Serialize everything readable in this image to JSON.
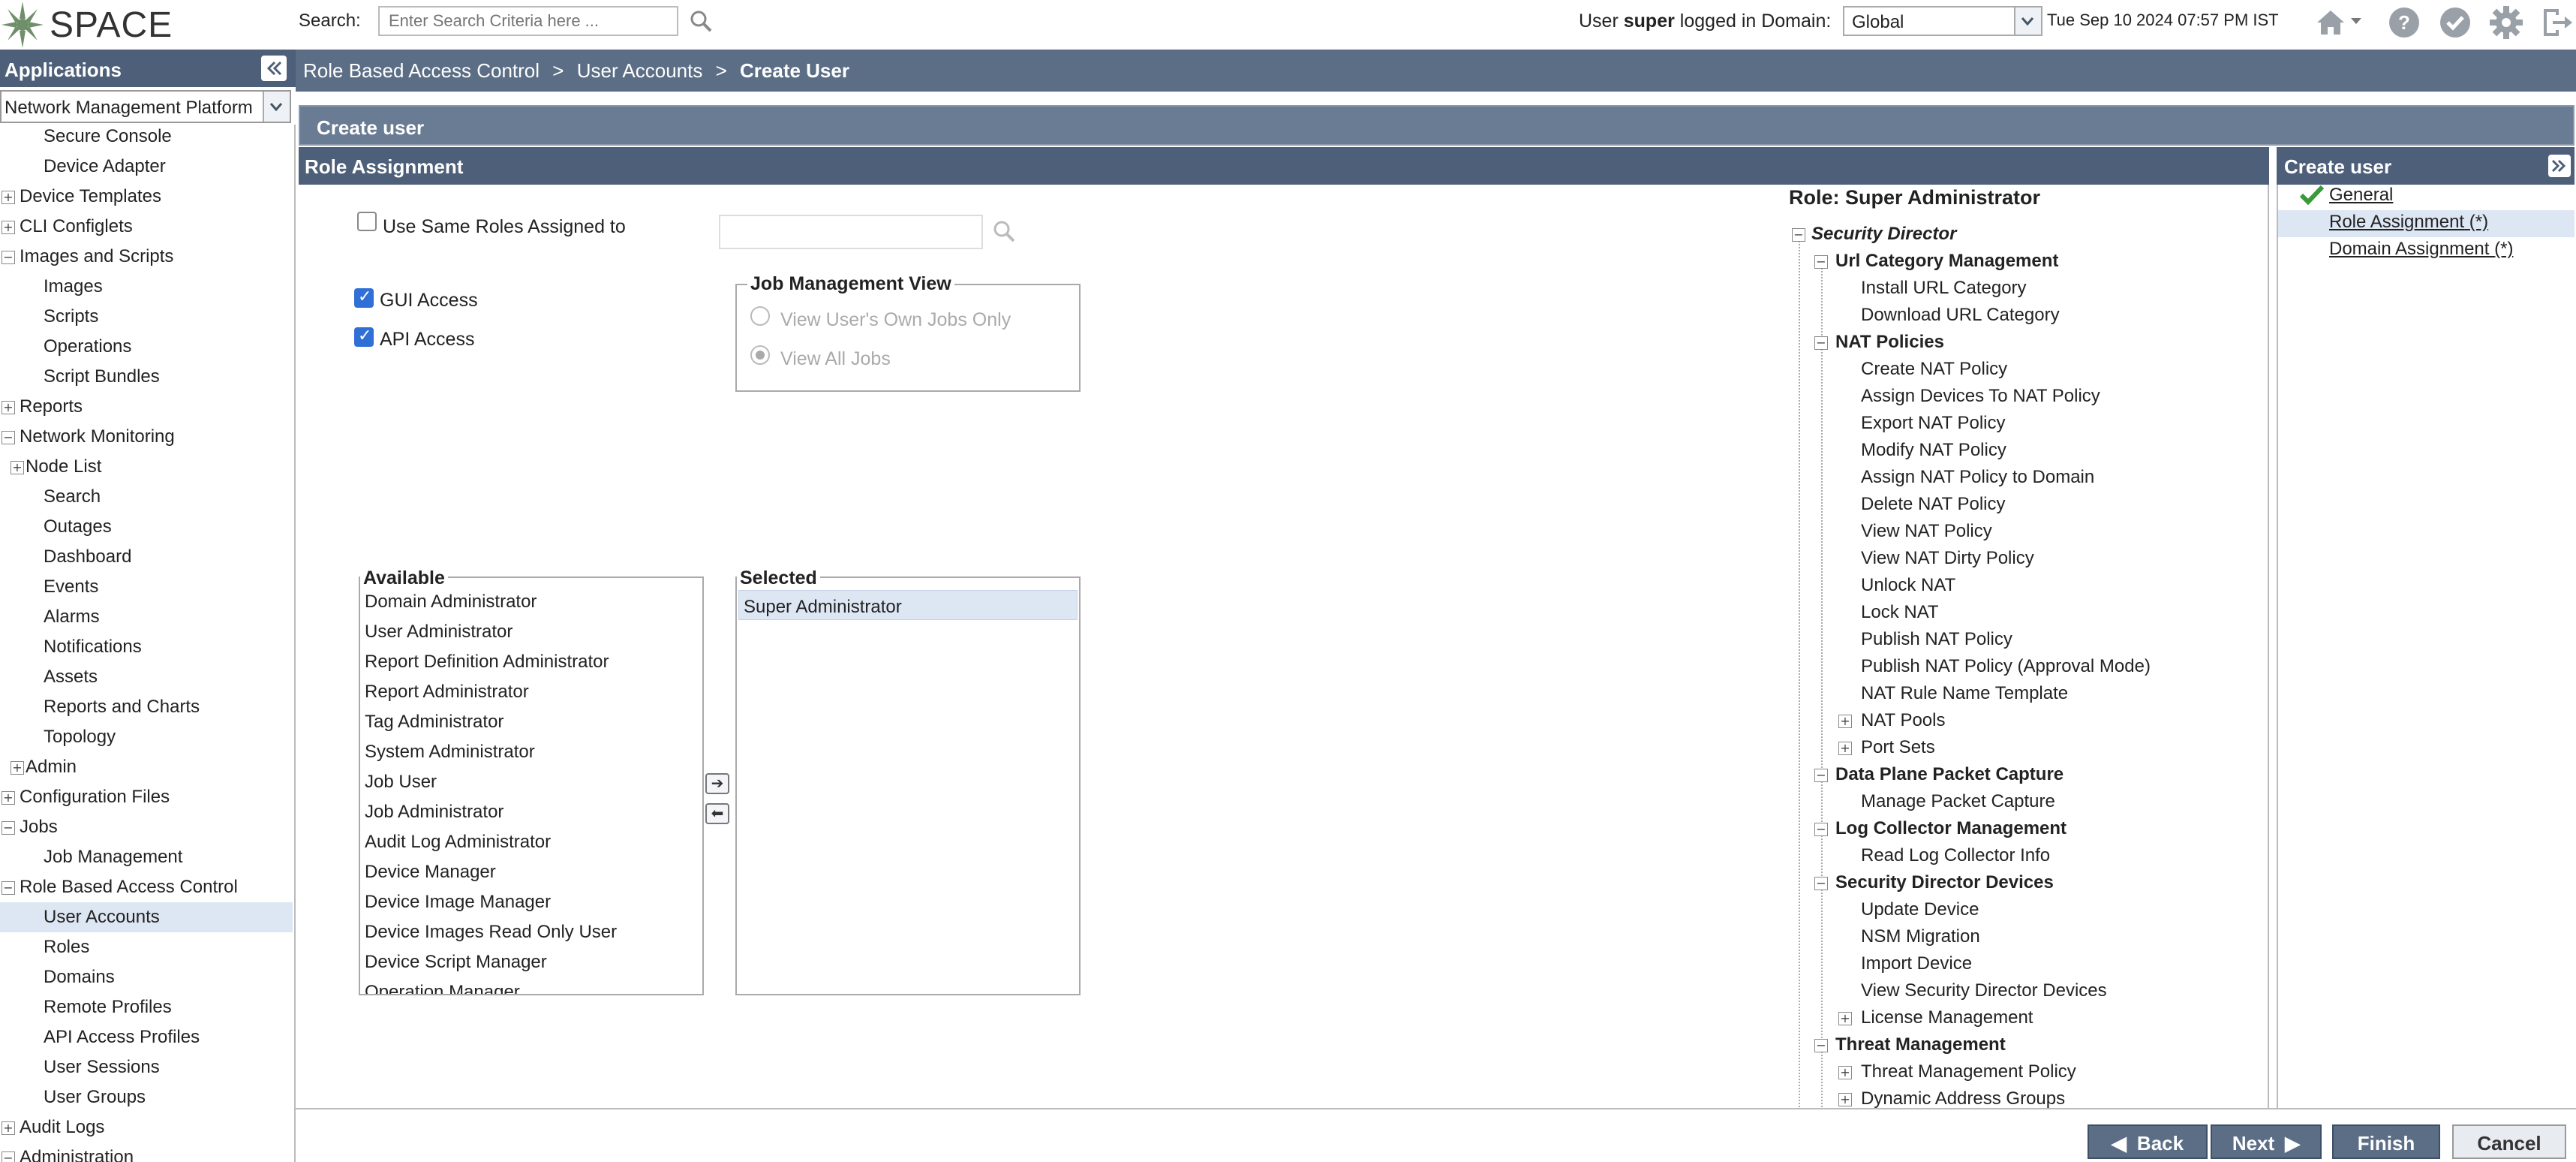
{
  "header": {
    "logo_text": "SPACE",
    "search_label": "Search:",
    "search_placeholder": "Enter Search Criteria here ...",
    "user_prefix": "User",
    "user_name": "super",
    "user_suffix": "logged in Domain:",
    "domain_value": "Global",
    "datetime": "Tue Sep 10 2024 07:57 PM IST"
  },
  "sidebar": {
    "title": "Applications",
    "app_select": "Network Management Platform",
    "items": [
      {
        "label": "Secure Console",
        "level": 2,
        "box": ""
      },
      {
        "label": "Device Adapter",
        "level": 2,
        "box": ""
      },
      {
        "label": "Device Templates",
        "level": 0,
        "box": "+"
      },
      {
        "label": "CLI Configlets",
        "level": 0,
        "box": "+"
      },
      {
        "label": "Images and Scripts",
        "level": 0,
        "box": "−"
      },
      {
        "label": "Images",
        "level": 2,
        "box": ""
      },
      {
        "label": "Scripts",
        "level": 2,
        "box": ""
      },
      {
        "label": "Operations",
        "level": 2,
        "box": ""
      },
      {
        "label": "Script Bundles",
        "level": 2,
        "box": ""
      },
      {
        "label": "Reports",
        "level": 0,
        "box": "+"
      },
      {
        "label": "Network Monitoring",
        "level": 0,
        "box": "−"
      },
      {
        "label": "Node List",
        "level": 1,
        "box": "+"
      },
      {
        "label": "Search",
        "level": 2,
        "box": ""
      },
      {
        "label": "Outages",
        "level": 2,
        "box": ""
      },
      {
        "label": "Dashboard",
        "level": 2,
        "box": ""
      },
      {
        "label": "Events",
        "level": 2,
        "box": ""
      },
      {
        "label": "Alarms",
        "level": 2,
        "box": ""
      },
      {
        "label": "Notifications",
        "level": 2,
        "box": ""
      },
      {
        "label": "Assets",
        "level": 2,
        "box": ""
      },
      {
        "label": "Reports and Charts",
        "level": 2,
        "box": ""
      },
      {
        "label": "Topology",
        "level": 2,
        "box": ""
      },
      {
        "label": "Admin",
        "level": 1,
        "box": "+"
      },
      {
        "label": "Configuration Files",
        "level": 0,
        "box": "+"
      },
      {
        "label": "Jobs",
        "level": 0,
        "box": "−"
      },
      {
        "label": "Job Management",
        "level": 2,
        "box": ""
      },
      {
        "label": "Role Based Access Control",
        "level": 0,
        "box": "−"
      },
      {
        "label": "User Accounts",
        "level": 2,
        "box": "",
        "selected": true
      },
      {
        "label": "Roles",
        "level": 2,
        "box": ""
      },
      {
        "label": "Domains",
        "level": 2,
        "box": ""
      },
      {
        "label": "Remote Profiles",
        "level": 2,
        "box": ""
      },
      {
        "label": "API Access Profiles",
        "level": 2,
        "box": ""
      },
      {
        "label": "User Sessions",
        "level": 2,
        "box": ""
      },
      {
        "label": "User Groups",
        "level": 2,
        "box": ""
      },
      {
        "label": "Audit Logs",
        "level": 0,
        "box": "+"
      },
      {
        "label": "Administration",
        "level": 0,
        "box": "−"
      }
    ]
  },
  "breadcrumb": {
    "items": [
      "Role Based Access Control",
      "User Accounts"
    ],
    "separator": ">",
    "current": "Create User"
  },
  "form": {
    "title": "Create user",
    "section": "Role Assignment",
    "use_same_roles_label": "Use Same Roles Assigned to",
    "gui_access_label": "GUI Access",
    "api_access_label": "API Access",
    "job_view_legend": "Job Management View",
    "job_view_own": "View User's Own Jobs Only",
    "job_view_all": "View All Jobs",
    "available_legend": "Available",
    "selected_legend": "Selected",
    "available_roles": [
      "Domain Administrator",
      "User Administrator",
      "Report Definition Administrator",
      "Report Administrator",
      "Tag Administrator",
      "System Administrator",
      "Job User",
      "Job Administrator",
      "Audit Log Administrator",
      "Device Manager",
      "Device Image Manager",
      "Device Images Read Only User",
      "Device Script Manager",
      "Operation Manager"
    ],
    "selected_roles": [
      "Super Administrator"
    ],
    "move_right": "➔",
    "move_left": "⬅"
  },
  "role_tree": {
    "title": "Role: Super Administrator",
    "nodes": [
      {
        "label": "Security Director",
        "level": 0,
        "box": "−",
        "style": "bi"
      },
      {
        "label": "Url Category Management",
        "level": 1,
        "box": "−",
        "style": "b"
      },
      {
        "label": "Install URL Category",
        "level": 2,
        "box": "",
        "style": ""
      },
      {
        "label": "Download URL Category",
        "level": 2,
        "box": "",
        "style": ""
      },
      {
        "label": "NAT Policies",
        "level": 1,
        "box": "−",
        "style": "b"
      },
      {
        "label": "Create NAT Policy",
        "level": 2,
        "box": "",
        "style": ""
      },
      {
        "label": "Assign Devices To NAT Policy",
        "level": 2,
        "box": "",
        "style": ""
      },
      {
        "label": "Export NAT Policy",
        "level": 2,
        "box": "",
        "style": ""
      },
      {
        "label": "Modify NAT Policy",
        "level": 2,
        "box": "",
        "style": ""
      },
      {
        "label": "Assign NAT Policy to Domain",
        "level": 2,
        "box": "",
        "style": ""
      },
      {
        "label": "Delete NAT Policy",
        "level": 2,
        "box": "",
        "style": ""
      },
      {
        "label": "View NAT Policy",
        "level": 2,
        "box": "",
        "style": ""
      },
      {
        "label": "View NAT Dirty Policy",
        "level": 2,
        "box": "",
        "style": ""
      },
      {
        "label": "Unlock NAT",
        "level": 2,
        "box": "",
        "style": ""
      },
      {
        "label": "Lock NAT",
        "level": 2,
        "box": "",
        "style": ""
      },
      {
        "label": "Publish NAT Policy",
        "level": 2,
        "box": "",
        "style": ""
      },
      {
        "label": "Publish NAT Policy (Approval Mode)",
        "level": 2,
        "box": "",
        "style": ""
      },
      {
        "label": "NAT Rule Name Template",
        "level": 2,
        "box": "",
        "style": ""
      },
      {
        "label": "NAT Pools",
        "level": 2,
        "box": "+",
        "style": ""
      },
      {
        "label": "Port Sets",
        "level": 2,
        "box": "+",
        "style": ""
      },
      {
        "label": "Data Plane Packet Capture",
        "level": 1,
        "box": "−",
        "style": "b"
      },
      {
        "label": "Manage Packet Capture",
        "level": 2,
        "box": "",
        "style": ""
      },
      {
        "label": "Log Collector Management",
        "level": 1,
        "box": "−",
        "style": "b"
      },
      {
        "label": "Read Log Collector Info",
        "level": 2,
        "box": "",
        "style": ""
      },
      {
        "label": "Security Director Devices",
        "level": 1,
        "box": "−",
        "style": "b"
      },
      {
        "label": "Update Device",
        "level": 2,
        "box": "",
        "style": ""
      },
      {
        "label": "NSM Migration",
        "level": 2,
        "box": "",
        "style": ""
      },
      {
        "label": "Import Device",
        "level": 2,
        "box": "",
        "style": ""
      },
      {
        "label": "View Security Director Devices",
        "level": 2,
        "box": "",
        "style": ""
      },
      {
        "label": "License Management",
        "level": 2,
        "box": "+",
        "style": ""
      },
      {
        "label": "Threat Management",
        "level": 1,
        "box": "−",
        "style": "b"
      },
      {
        "label": "Threat Management Policy",
        "level": 2,
        "box": "+",
        "style": ""
      },
      {
        "label": "Dynamic Address Groups",
        "level": 2,
        "box": "+",
        "style": ""
      }
    ]
  },
  "right_panel": {
    "title": "Create user",
    "steps": [
      {
        "label": "General",
        "required": ""
      },
      {
        "label": "Role Assignment",
        "required": "(*)"
      },
      {
        "label": "Domain Assignment",
        "required": "(*)"
      }
    ]
  },
  "footer": {
    "back": "Back",
    "next": "Next",
    "finish": "Finish",
    "cancel": "Cancel"
  },
  "colors": {
    "header_dark": "#4e6079",
    "breadcrumb": "#5b6e86",
    "selection": "#dde6f3",
    "check_blue": "#2f6fd6"
  }
}
